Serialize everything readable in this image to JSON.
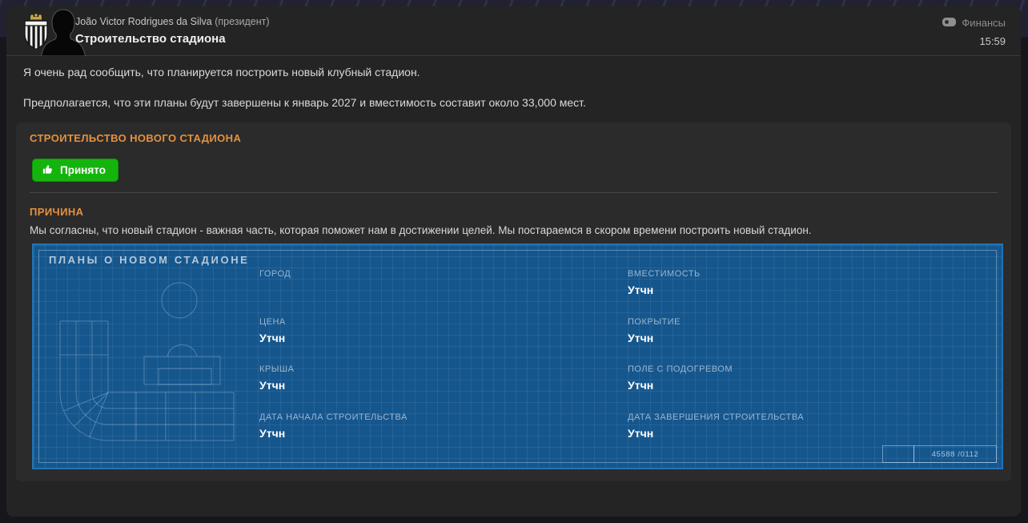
{
  "header": {
    "club_badge": "santos-crest",
    "sender_name": "João Victor Rodrigues da Silva",
    "sender_role": "(президент)",
    "subject": "Строительство стадиона",
    "category_label": "Финансы",
    "category_icon": "finances-icon",
    "time": "15:59"
  },
  "message": {
    "paragraphs": [
      "Я очень рад сообщить, что планируется построить новый клубный стадион.",
      "Предполагается, что эти планы будут завершены к январь 2027 и вместимость составит около 33,000 мест."
    ]
  },
  "card": {
    "section_title": "СТРОИТЕЛЬСТВО НОВОГО СТАДИОНА",
    "accept_button_label": "Принято",
    "accept_button_icon": "thumbs-up-icon",
    "reason_title": "ПРИЧИНА",
    "reason_text": "Мы согласны, что новый стадион - важная часть, которая поможет нам в достижении целей. Мы постараемся в скором времени построить новый стадион."
  },
  "blueprint": {
    "title": "ПЛАНЫ О НОВОМ СТАДИОНЕ",
    "fields": [
      {
        "label": "ГОРОД",
        "value": ""
      },
      {
        "label": "ЦЕНА",
        "value": "Утчн"
      },
      {
        "label": "КРЫША",
        "value": "Утчн"
      },
      {
        "label": "ДАТА НАЧАЛА СТРОИТЕЛЬСТВА",
        "value": "Утчн"
      },
      {
        "label": "ВМЕСТИМОСТЬ",
        "value": "Утчн"
      },
      {
        "label": "ПОКРЫТИЕ",
        "value": "Утчн"
      },
      {
        "label": "ПОЛЕ С ПОДОГРЕВОМ",
        "value": "Утчн"
      },
      {
        "label": "ДАТА ЗАВЕРШЕНИЯ СТРОИТЕЛЬСТВА",
        "value": "Утчн"
      }
    ],
    "stamp_number": "45588 /0112"
  },
  "colors": {
    "accent_orange": "#e6913e",
    "accept_green": "#15b40d",
    "blueprint_fill": "#15568d",
    "blueprint_border": "#2173b3",
    "panel_bg": "#242424",
    "card_bg": "#2b2b2b"
  }
}
